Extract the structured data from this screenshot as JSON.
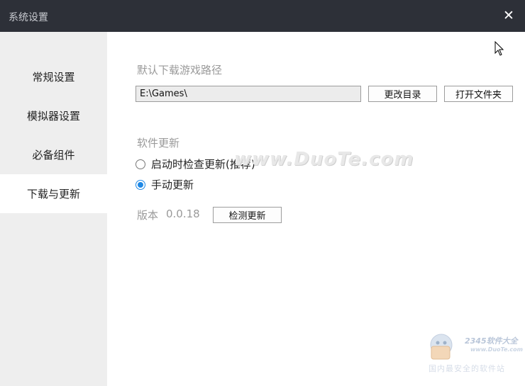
{
  "window": {
    "title": "系统设置",
    "close_glyph": "✕"
  },
  "sidebar": {
    "items": [
      {
        "label": "常规设置",
        "active": false
      },
      {
        "label": "模拟器设置",
        "active": false
      },
      {
        "label": "必备组件",
        "active": false
      },
      {
        "label": "下载与更新",
        "active": true
      }
    ]
  },
  "download": {
    "section_label": "默认下载游戏路径",
    "path_value": "E:\\Games\\",
    "change_dir_button": "更改目录",
    "open_folder_button": "打开文件夹"
  },
  "update": {
    "section_label": "软件更新",
    "options": [
      {
        "label": "启动时检查更新(推荐)",
        "checked": false
      },
      {
        "label": "手动更新",
        "checked": true
      }
    ],
    "version_label": "版本",
    "version_value": "0.0.18",
    "check_button": "检测更新"
  },
  "watermark": {
    "text": "www.DuoTe.com"
  },
  "logo": {
    "brand": "2345软件大全",
    "url": "www.DuoTe.com",
    "tagline": "国内最安全的软件站"
  },
  "colors": {
    "titlebar": "#2d3038",
    "sidebar": "#eeeeee",
    "accent": "#1e88e5"
  }
}
